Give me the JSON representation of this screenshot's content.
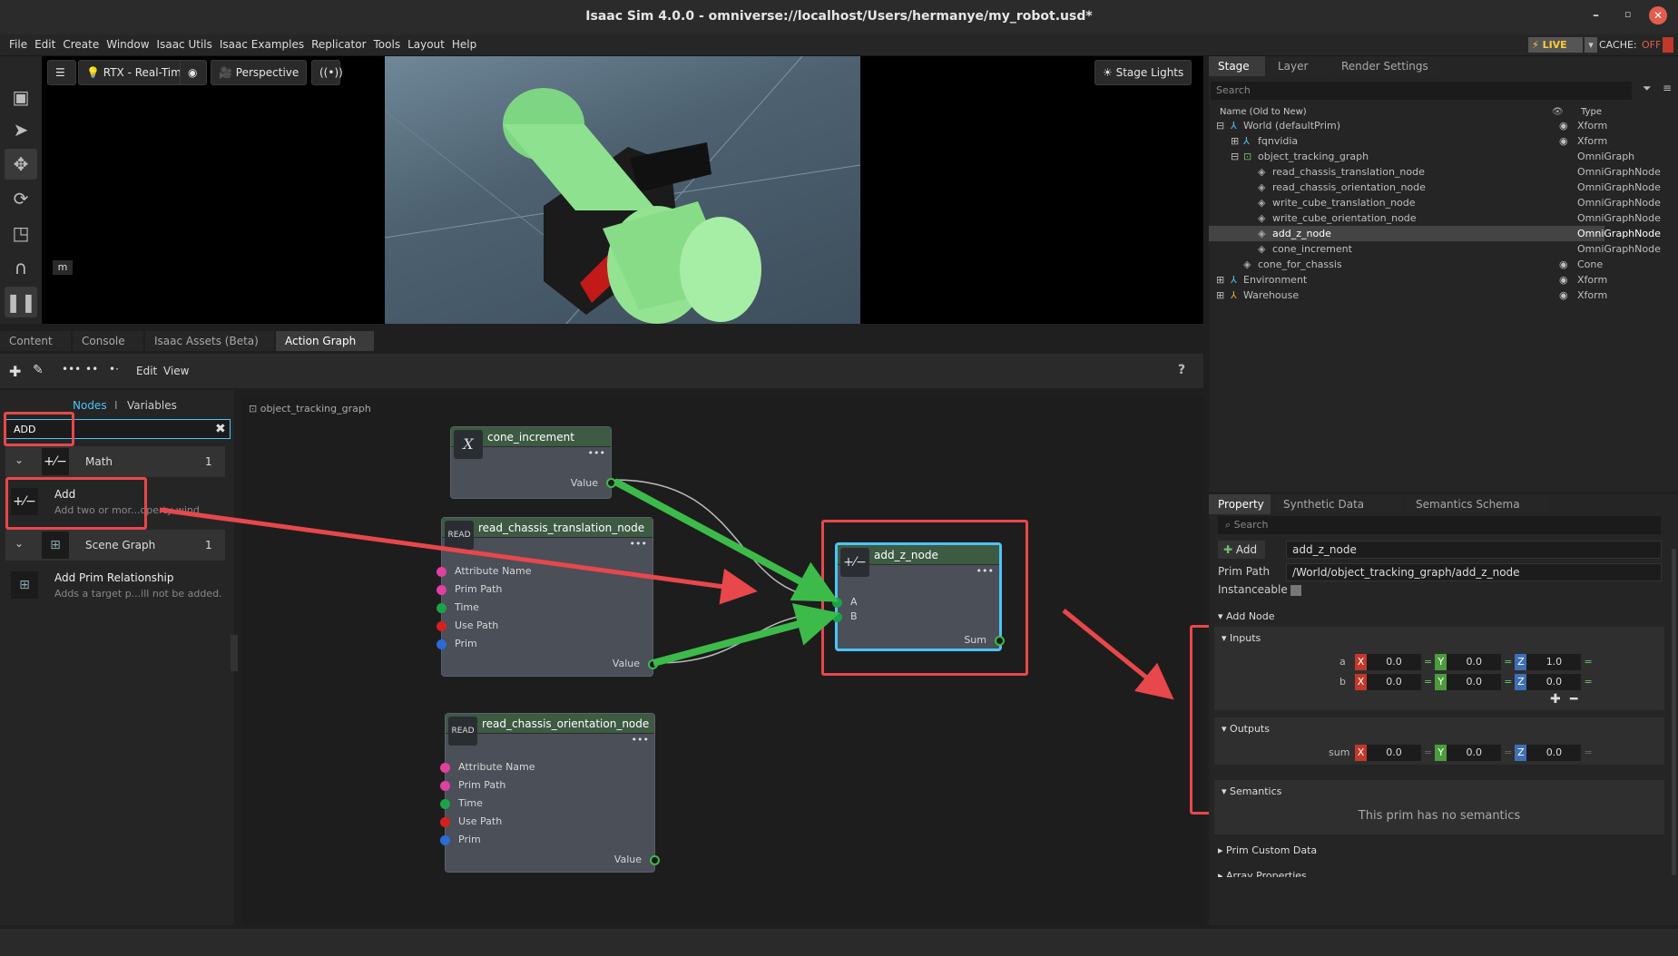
{
  "title": "Isaac Sim 4.0.0 - omniverse://localhost/Users/hermanye/my_robot.usd*",
  "menu": [
    "File",
    "Edit",
    "Create",
    "Window",
    "Isaac Utils",
    "Isaac Examples",
    "Replicator",
    "Tools",
    "Layout",
    "Help"
  ],
  "status": {
    "live": "LIVE",
    "cache": "CACHE:",
    "cache_state": "OFF"
  },
  "viewport": {
    "renderer": "RTX - Real-Time",
    "camera": "Perspective",
    "lights": "Stage Lights",
    "units": "m"
  },
  "bottom_tabs": [
    "Content",
    "Console",
    "Isaac Assets (Beta)",
    "Action Graph"
  ],
  "graph_toolbar": {
    "edit": "Edit",
    "view": "View",
    "help": "?"
  },
  "node_library": {
    "tab_nodes": "Nodes",
    "separator": "I",
    "tab_variables": "Variables",
    "search_value": "ADD",
    "categories": [
      {
        "name": "Math",
        "count": "1",
        "item": "Add",
        "desc": "Add two or mor...operty  wind"
      },
      {
        "name": "Scene Graph",
        "count": "1",
        "item": "Add Prim Relationship",
        "desc": "Adds a target p...ill not be added."
      }
    ]
  },
  "graph": {
    "breadcrumb": "object_tracking_graph",
    "nodes": {
      "cone_increment": {
        "title": "cone_increment",
        "icon": "X",
        "out": "Value"
      },
      "read_translation": {
        "title": "read_chassis_translation_node",
        "icon": "READ",
        "ports": [
          "Attribute Name",
          "Prim Path",
          "Time",
          "Use Path",
          "Prim"
        ],
        "out": "Value"
      },
      "read_orientation": {
        "title": "read_chassis_orientation_node",
        "icon": "READ",
        "ports": [
          "Attribute Name",
          "Prim Path",
          "Time",
          "Use Path",
          "Prim"
        ],
        "out": "Value"
      },
      "add_z": {
        "title": "add_z_node",
        "in_a": "A",
        "in_b": "B",
        "out": "Sum"
      }
    }
  },
  "stage": {
    "tabs": [
      "Stage",
      "Layer",
      "Render Settings"
    ],
    "search_placeholder": "Search",
    "col_name": "Name (Old to New)",
    "col_type": "Type",
    "rows": [
      {
        "name": "World (defaultPrim)",
        "type": "Xform"
      },
      {
        "name": "fqnvidia",
        "type": "Xform"
      },
      {
        "name": "object_tracking_graph",
        "type": "OmniGraph"
      },
      {
        "name": "read_chassis_translation_node",
        "type": "OmniGraphNode"
      },
      {
        "name": "read_chassis_orientation_node",
        "type": "OmniGraphNode"
      },
      {
        "name": "write_cube_translation_node",
        "type": "OmniGraphNode"
      },
      {
        "name": "write_cube_orientation_node",
        "type": "OmniGraphNode"
      },
      {
        "name": "add_z_node",
        "type": "OmniGraphNode"
      },
      {
        "name": "cone_increment",
        "type": "OmniGraphNode"
      },
      {
        "name": "cone_for_chassis",
        "type": "Cone"
      },
      {
        "name": "Environment",
        "type": "Xform"
      },
      {
        "name": "Warehouse",
        "type": "Xform"
      }
    ]
  },
  "property": {
    "tabs": [
      "Property",
      "Synthetic Data Recorder",
      "Semantics Schema Editor"
    ],
    "search_placeholder": "Search",
    "add_label": "Add",
    "name_value": "add_z_node",
    "prim_path_label": "Prim Path",
    "prim_path": "/World/object_tracking_graph/add_z_node",
    "instanceable_label": "Instanceable",
    "add_node_label": "Add Node",
    "inputs_label": "Inputs",
    "outputs_label": "Outputs",
    "a": {
      "label": "a",
      "x": "0.0",
      "y": "0.0",
      "z": "1.0"
    },
    "b": {
      "label": "b",
      "x": "0.0",
      "y": "0.0",
      "z": "0.0"
    },
    "sum": {
      "label": "sum",
      "x": "0.0",
      "y": "0.0",
      "z": "0.0"
    },
    "axis_x": "X",
    "axis_y": "Y",
    "axis_z": "Z",
    "semantics_label": "Semantics",
    "no_semantics": "This prim has no semantics",
    "custom_data_label": "Prim Custom Data",
    "array_props_label": "Array Properties"
  },
  "colors": {
    "accent_red": "#e8474b",
    "accent_green": "#3dbb4a",
    "node_select": "#4fc3f7"
  }
}
